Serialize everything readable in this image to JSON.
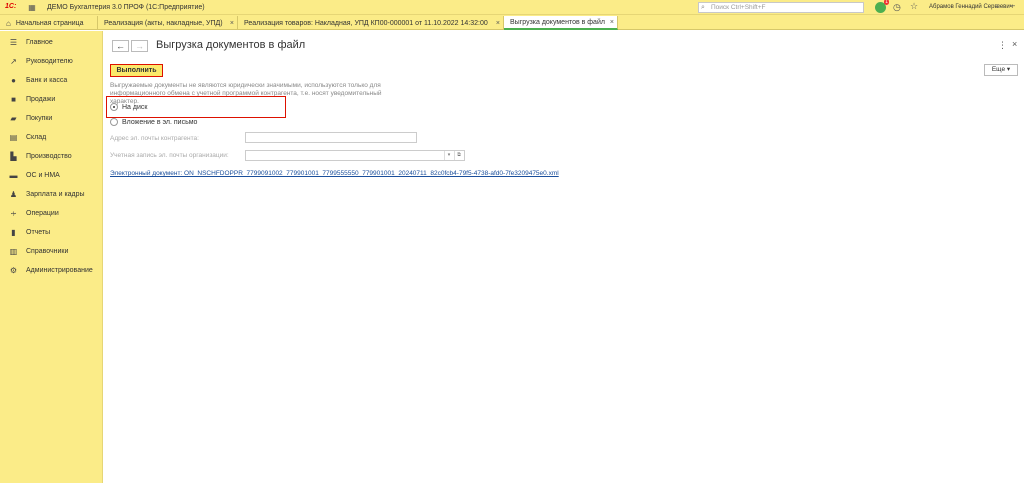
{
  "titlebar": {
    "logo": "1С:",
    "app_title": "ДЕМО Бухгалтерия 3.0 ПРОФ  (1С:Предприятие)",
    "search_placeholder": "Поиск Ctrl+Shift+F",
    "notif_count": "1",
    "user_name": "Абрамов Геннадий Сергеевич"
  },
  "tabs": [
    {
      "label": "Начальная страница"
    },
    {
      "label": "Реализация (акты, накладные, УПД)"
    },
    {
      "label": "Реализация товаров: Накладная, УПД КП00-000001 от 11.10.2022 14:32:00"
    },
    {
      "label": "Выгрузка документов в файл"
    }
  ],
  "sidebar": {
    "items": [
      {
        "label": "Главное",
        "icon": "menu-icon"
      },
      {
        "label": "Руководителю",
        "icon": "trend-icon"
      },
      {
        "label": "Банк и касса",
        "icon": "bank-icon"
      },
      {
        "label": "Продажи",
        "icon": "bag-icon"
      },
      {
        "label": "Покупки",
        "icon": "cart-icon"
      },
      {
        "label": "Склад",
        "icon": "warehouse-icon"
      },
      {
        "label": "Производство",
        "icon": "factory-icon"
      },
      {
        "label": "ОС и НМА",
        "icon": "truck-icon"
      },
      {
        "label": "Зарплата и кадры",
        "icon": "person-icon"
      },
      {
        "label": "Операции",
        "icon": "operations-icon"
      },
      {
        "label": "Отчеты",
        "icon": "report-icon"
      },
      {
        "label": "Справочники",
        "icon": "book-icon"
      },
      {
        "label": "Администрирование",
        "icon": "gear-icon"
      }
    ]
  },
  "page": {
    "title": "Выгрузка документов в файл",
    "execute_label": "Выполнить",
    "more_label": "Еще",
    "notice": "Выгружаемые документы не являются юридически значимыми, используются только для информационного обмена с учетной программой контрагента, т.е. носят уведомительный характер.",
    "radio_disk": "На диск",
    "radio_email": "Вложение в эл. письмо",
    "email_label": "Адрес эл. почты контрагента:",
    "account_label": "Учетная запись эл. почты организации:",
    "file_link": "Электронный документ: ON_NSCHFDOPPR_7799091002_779901001_7799555550_779901001_20240711_82c0fcb4-79f5-4738-afd0-7fe3209475e0.xml"
  }
}
